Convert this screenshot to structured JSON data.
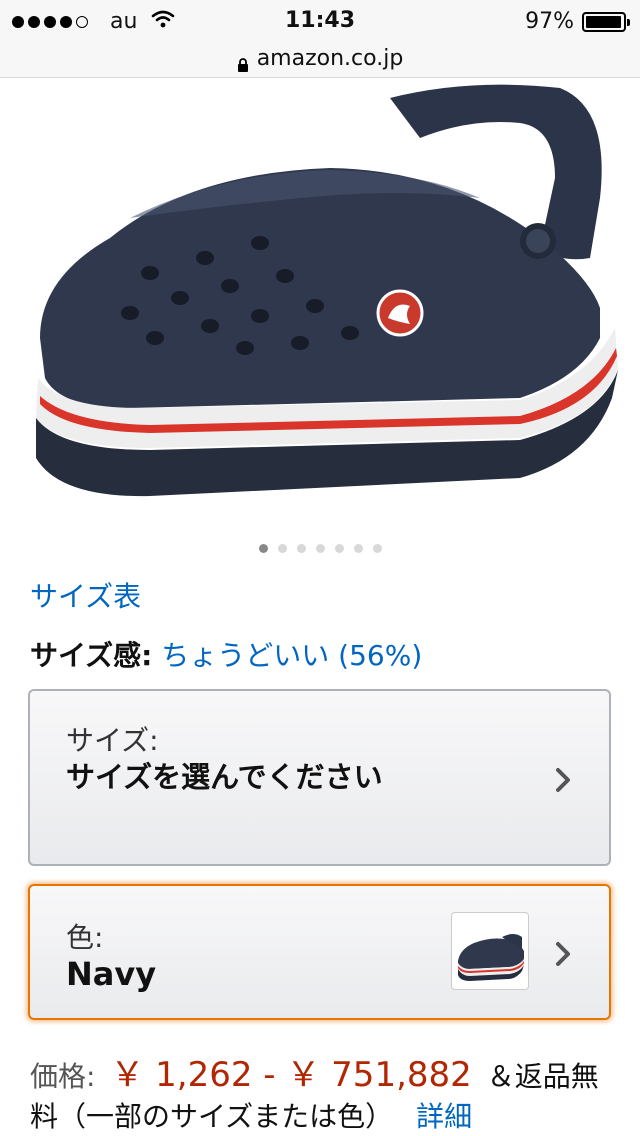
{
  "status_bar": {
    "carrier": "au",
    "time": "11:43",
    "battery": "97%",
    "battery_level": 0.97,
    "signal_bars": 4
  },
  "url_bar": {
    "domain": "amazon.co.jp"
  },
  "product": {
    "image_count": 7,
    "active_image": 0,
    "size_chart_link": "サイズ表",
    "fit_label": "サイズ感:",
    "fit_value": "ちょうどいい (56%)",
    "size": {
      "label": "サイズ:",
      "value": "サイズを選んでください"
    },
    "color": {
      "label": "色:",
      "value": "Navy"
    },
    "price": {
      "label": "価格:",
      "value": "￥ 1,262 - ￥ 751,882",
      "note": "＆返品無料（一部のサイズまたは色）",
      "details_link": "詳細"
    }
  },
  "colors": {
    "link": "#0066c0",
    "price": "#b12704",
    "focus": "#e77600",
    "shoe_navy": "#2b3448",
    "stripe_red": "#d9352b"
  }
}
